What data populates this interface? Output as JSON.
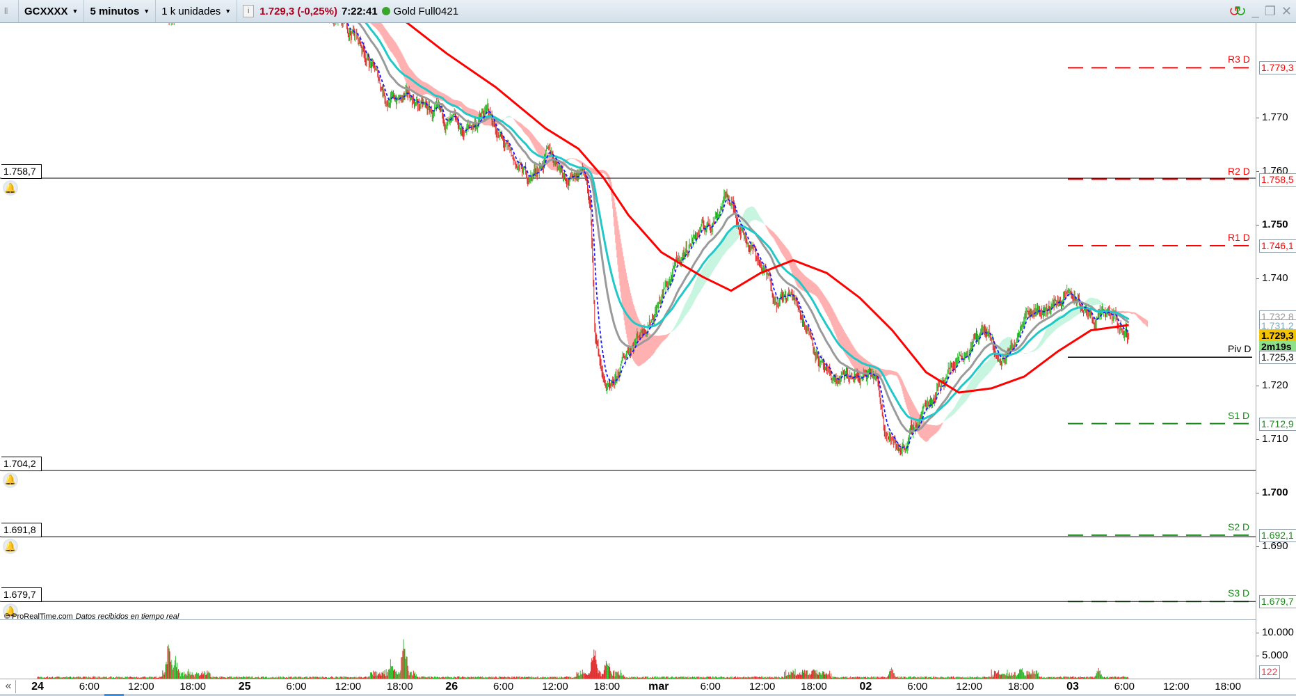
{
  "toolbar": {
    "symbol": "GCXXXX",
    "timeframe": "5 minutos",
    "units": "1 k unidades",
    "last_price": "1.729,3 (-0,25%)",
    "time": "7:22:41",
    "instrument": "Gold Full0421",
    "colors": {
      "last_price": "#b00020",
      "status_dot": "#3aa52b"
    }
  },
  "window_controls": {
    "refresh": "refresh-icon",
    "minimize": "_",
    "restore": "❐",
    "close": "✕"
  },
  "price_axis": {
    "ticks": [
      {
        "value": 1770,
        "label": "1.770",
        "bold": false
      },
      {
        "value": 1760,
        "label": "1.760",
        "bold": false
      },
      {
        "value": 1750,
        "label": "1.750",
        "bold": true
      },
      {
        "value": 1740,
        "label": "1.740",
        "bold": false
      },
      {
        "value": 1720,
        "label": "1.720",
        "bold": false
      },
      {
        "value": 1710,
        "label": "1.710",
        "bold": false
      },
      {
        "value": 1700,
        "label": "1.700",
        "bold": true
      },
      {
        "value": 1690,
        "label": "1.690",
        "bold": false
      }
    ],
    "markers": [
      {
        "value": 1732.8,
        "label": "1.732,8",
        "color": "#999999",
        "bg": "#ffffff"
      },
      {
        "value": 1731.2,
        "label": "1.731,2",
        "color": "#7fa9b8",
        "bg": "#ffffff"
      },
      {
        "value": 1729.3,
        "label": "1.729,3",
        "color": "#000000",
        "bg": "#f5c400"
      },
      {
        "value": 1727.3,
        "label": "2m19s",
        "color": "#000000",
        "bg": "#8fe08a"
      }
    ]
  },
  "pivots": [
    {
      "name": "R3 D",
      "value": 1779.3,
      "label": "1.779,3",
      "color": "#ff0000",
      "dashed": true
    },
    {
      "name": "R2 D",
      "value": 1758.5,
      "label": "1.758,5",
      "color": "#ff0000",
      "dashed": true
    },
    {
      "name": "R1 D",
      "value": 1746.1,
      "label": "1.746,1",
      "color": "#ff0000",
      "dashed": true
    },
    {
      "name": "Piv D",
      "value": 1725.3,
      "label": "1.725,3",
      "color": "#000000",
      "dashed": false
    },
    {
      "name": "S1 D",
      "value": 1712.9,
      "label": "1.712,9",
      "color": "#1a8a1a",
      "dashed": true
    },
    {
      "name": "S2 D",
      "value": 1692.1,
      "label": "1.692,1",
      "color": "#1a8a1a",
      "dashed": true
    },
    {
      "name": "S3 D",
      "value": 1679.7,
      "label": "1.679,7",
      "color": "#1a8a1a",
      "dashed": true
    }
  ],
  "alerts": [
    {
      "value": 1758.7,
      "label": "1.758,7"
    },
    {
      "value": 1704.2,
      "label": "1.704,2"
    },
    {
      "value": 1691.8,
      "label": "1.691,8"
    },
    {
      "value": 1679.7,
      "label": "1.679,7"
    }
  ],
  "credit": {
    "brand": "© ProRealTime.com",
    "note": "Datos recibidos en tiempo real"
  },
  "volume_axis": {
    "ticks": [
      {
        "value": 10000,
        "label": "10.000"
      },
      {
        "value": 5000,
        "label": "5.000"
      }
    ],
    "current": "122"
  },
  "time_axis": {
    "labels": [
      {
        "h": 0,
        "label": "24",
        "day": true
      },
      {
        "h": 6,
        "label": "6:00"
      },
      {
        "h": 12,
        "label": "12:00"
      },
      {
        "h": 18,
        "label": "18:00"
      },
      {
        "h": 24,
        "label": "25",
        "day": true
      },
      {
        "h": 30,
        "label": "6:00"
      },
      {
        "h": 36,
        "label": "12:00"
      },
      {
        "h": 42,
        "label": "18:00"
      },
      {
        "h": 48,
        "label": "26",
        "day": true
      },
      {
        "h": 54,
        "label": "6:00"
      },
      {
        "h": 60,
        "label": "12:00"
      },
      {
        "h": 66,
        "label": "18:00"
      },
      {
        "h": 72,
        "label": "mar",
        "day": true
      },
      {
        "h": 78,
        "label": "6:00"
      },
      {
        "h": 84,
        "label": "12:00"
      },
      {
        "h": 90,
        "label": "18:00"
      },
      {
        "h": 96,
        "label": "02",
        "day": true
      },
      {
        "h": 102,
        "label": "6:00"
      },
      {
        "h": 108,
        "label": "12:00"
      },
      {
        "h": 114,
        "label": "18:00"
      },
      {
        "h": 120,
        "label": "03",
        "day": true
      },
      {
        "h": 126,
        "label": "6:00"
      },
      {
        "h": 132,
        "label": "12:00"
      },
      {
        "h": 138,
        "label": "18:00"
      }
    ],
    "scroll_left": "«"
  },
  "series": {
    "price_path": [
      [
        0,
        1800
      ],
      [
        14,
        1792
      ],
      [
        15.7,
        1786
      ],
      [
        17,
        1795
      ],
      [
        33,
        1795
      ],
      [
        33.5,
        1788
      ],
      [
        36.8,
        1785.7
      ],
      [
        38.8,
        1779.6
      ],
      [
        40.6,
        1773.4
      ],
      [
        43.5,
        1773.4
      ],
      [
        45.5,
        1771
      ],
      [
        49.3,
        1767
      ],
      [
        52.2,
        1771
      ],
      [
        55,
        1761.8
      ],
      [
        57,
        1758.8
      ],
      [
        59.4,
        1763.4
      ],
      [
        61.8,
        1758.8
      ],
      [
        63.2,
        1761
      ],
      [
        64.1,
        1753.4
      ],
      [
        64.6,
        1730
      ],
      [
        65.6,
        1721
      ],
      [
        66.5,
        1718
      ],
      [
        68.5,
        1727
      ],
      [
        71.3,
        1733.4
      ],
      [
        74.2,
        1742.6
      ],
      [
        76.1,
        1748
      ],
      [
        78,
        1750.3
      ],
      [
        79.9,
        1755.7
      ],
      [
        81.9,
        1748.7
      ],
      [
        83.8,
        1742.6
      ],
      [
        85.7,
        1736.4
      ],
      [
        87.6,
        1736.4
      ],
      [
        89.5,
        1730.3
      ],
      [
        91.5,
        1721
      ],
      [
        93.4,
        1721
      ],
      [
        95.3,
        1721.7
      ],
      [
        97.2,
        1721
      ],
      [
        98.1,
        1713.2
      ],
      [
        99.6,
        1708
      ],
      [
        101,
        1710
      ],
      [
        103,
        1716.4
      ],
      [
        104.8,
        1721
      ],
      [
        106.8,
        1725.6
      ],
      [
        109.7,
        1730.3
      ],
      [
        111.6,
        1724
      ],
      [
        113,
        1727.1
      ],
      [
        114.4,
        1734.8
      ],
      [
        116.4,
        1734
      ],
      [
        118.3,
        1735.6
      ],
      [
        119.7,
        1737
      ],
      [
        122.1,
        1732.6
      ],
      [
        124.5,
        1732.6
      ],
      [
        126.5,
        1729.3
      ]
    ],
    "slow_ma": [
      [
        38,
        1790
      ],
      [
        42.6,
        1788
      ],
      [
        47.4,
        1782
      ],
      [
        53.1,
        1775.7
      ],
      [
        58.9,
        1768
      ],
      [
        62.7,
        1764.2
      ],
      [
        65.6,
        1758.8
      ],
      [
        68.5,
        1751.8
      ],
      [
        72.3,
        1744.9
      ],
      [
        77.1,
        1740.3
      ],
      [
        80.4,
        1737.7
      ],
      [
        83.8,
        1741
      ],
      [
        87.6,
        1743.4
      ],
      [
        91.5,
        1741
      ],
      [
        95.3,
        1736.4
      ],
      [
        99.1,
        1730.3
      ],
      [
        103,
        1722.5
      ],
      [
        106.8,
        1718.7
      ],
      [
        110.6,
        1719.5
      ],
      [
        114.4,
        1721.7
      ],
      [
        118.3,
        1726.4
      ],
      [
        122.1,
        1730.3
      ],
      [
        126.5,
        1731.3
      ]
    ],
    "volume_spikes": [
      [
        15.2,
        9000
      ],
      [
        16,
        5500
      ],
      [
        42.5,
        11000
      ],
      [
        41,
        5000
      ],
      [
        64.5,
        10000
      ],
      [
        66,
        6500
      ],
      [
        90,
        3000
      ],
      [
        114,
        3500
      ],
      [
        99,
        3000
      ],
      [
        123,
        2500
      ]
    ],
    "colors": {
      "up": "#2fbf2f",
      "down": "#e03030",
      "slow_ma": "#ff0000",
      "mid_ma": "#9a9a9a",
      "long_ma": "#20c8c8",
      "fast_ma": "#1a1aff",
      "cloud_down": "#ffb0b0",
      "cloud_up": "#c8f5e0"
    }
  }
}
